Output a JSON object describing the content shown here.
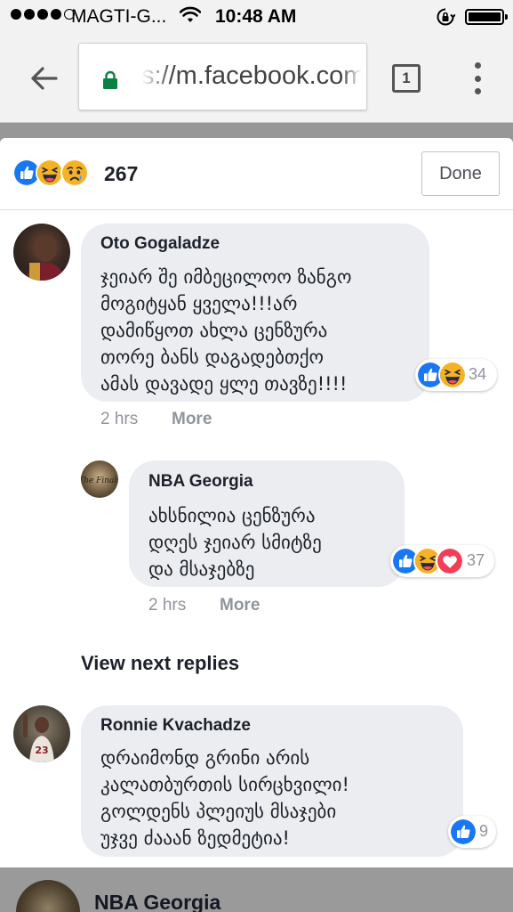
{
  "status_bar": {
    "carrier": "MAGTI-G...",
    "time": "10:48 AM"
  },
  "browser": {
    "url": "s://m.facebook.com",
    "tab_count": "1"
  },
  "reactions_header": {
    "icons": [
      "like-icon",
      "haha-icon",
      "sad-icon"
    ],
    "count": "267",
    "done_label": "Done"
  },
  "comments": [
    {
      "name": "Oto Gogaladze",
      "lines": [
        "ჯეიარ შე იმბეცილოო ზანგო",
        "მოგიტყან ყველა!!!არ",
        "დამიწყოთ ახლა ცენზურა",
        "თორე ბანს დაგადებთქო",
        "ამას დავადე ყლე თავზე!!!!"
      ],
      "reaction_icons": [
        "like-icon",
        "haha-icon"
      ],
      "reaction_count": "34",
      "time": "2 hrs",
      "more": "More"
    },
    {
      "name": "NBA Georgia",
      "lines": [
        "ახსნილია ცენზურა",
        "დღეს ჯეიარ სმიტზე",
        "და მსაჯებზე"
      ],
      "reaction_icons": [
        "like-icon",
        "haha-icon",
        "love-icon"
      ],
      "reaction_count": "37",
      "time": "2 hrs",
      "more": "More"
    },
    {
      "name": "Ronnie Kvachadze",
      "lines": [
        "დრაიმონდ გრინი არის",
        "კალათბურთის სირცხვილი!",
        "გოლდენს პლეიუს მსაჯები",
        "უჯვე ძააან ზედმეტია!"
      ],
      "reaction_icons": [
        "like-icon"
      ],
      "reaction_count": "9"
    }
  ],
  "view_next_replies": "View next replies",
  "next_comment_name": "NBA Georgia",
  "colors": {
    "like": "#1877f2",
    "haha": "#f7b125",
    "love": "#f33e58",
    "bubble": "#ebedf0"
  }
}
